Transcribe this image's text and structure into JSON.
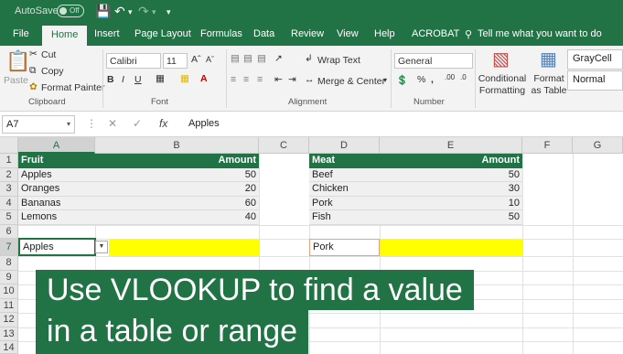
{
  "titlebar": {
    "autosave_label": "AutoSave",
    "autosave_state": "Off"
  },
  "tabs": [
    "File",
    "Home",
    "Insert",
    "Page Layout",
    "Formulas",
    "Data",
    "Review",
    "View",
    "Help",
    "ACROBAT"
  ],
  "active_tab": "Home",
  "tell_me": "Tell me what you want to do",
  "ribbon": {
    "paste": "Paste",
    "cut": "Cut",
    "copy": "Copy",
    "format_painter": "Format Painter",
    "clipboard_label": "Clipboard",
    "font_name": "Calibri",
    "font_size": "11",
    "font_label": "Font",
    "wrap_text": "Wrap Text",
    "merge_center": "Merge & Center",
    "alignment_label": "Alignment",
    "number_format": "General",
    "number_label": "Number",
    "conditional_formatting": "Conditional Formatting",
    "format_as_table": "Format as Table",
    "style_graycell": "GrayCell",
    "style_normal": "Normal"
  },
  "formula_bar": {
    "name_box": "A7",
    "value": "Apples"
  },
  "columns": [
    "A",
    "B",
    "C",
    "D",
    "E",
    "F",
    "G"
  ],
  "rows": [
    "1",
    "2",
    "3",
    "4",
    "5",
    "6",
    "7",
    "8",
    "9",
    "10",
    "11",
    "12",
    "13",
    "14"
  ],
  "table_fruit": {
    "headers": [
      "Fruit",
      "Amount"
    ],
    "rows": [
      [
        "Apples",
        "50"
      ],
      [
        "Oranges",
        "20"
      ],
      [
        "Bananas",
        "60"
      ],
      [
        "Lemons",
        "40"
      ]
    ]
  },
  "table_meat": {
    "headers": [
      "Meat",
      "Amount"
    ],
    "rows": [
      [
        "Beef",
        "50"
      ],
      [
        "Chicken",
        "30"
      ],
      [
        "Pork",
        "10"
      ],
      [
        "Fish",
        "50"
      ]
    ]
  },
  "lookup": {
    "a7": "Apples",
    "d7": "Pork"
  },
  "banner": {
    "line1": "Use VLOOKUP to find a value",
    "line2": "in a table or range"
  },
  "colors": {
    "excel_green": "#217346",
    "highlight_yellow": "#ffff00"
  }
}
